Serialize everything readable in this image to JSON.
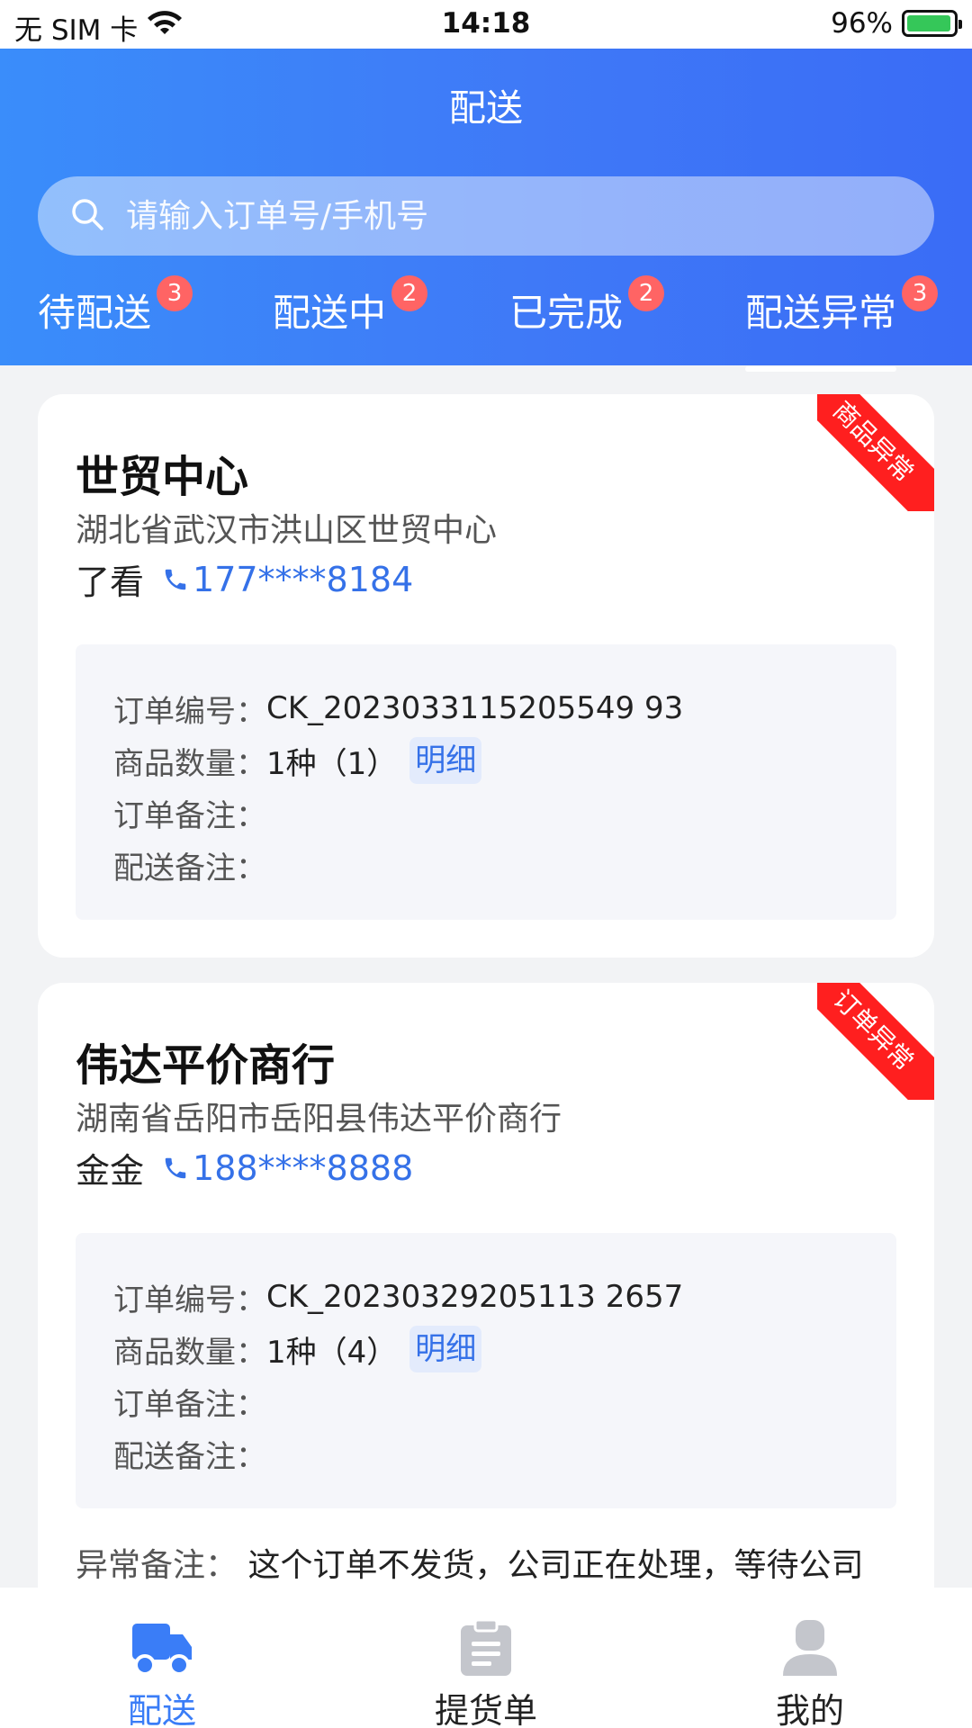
{
  "status_bar": {
    "carrier": "无 SIM 卡",
    "time": "14:18",
    "battery": "96%",
    "battery_level": 0.96
  },
  "header": {
    "title": "配送",
    "search_placeholder": "请输入订单号/手机号"
  },
  "tabs": [
    {
      "label": "待配送",
      "badge": "3"
    },
    {
      "label": "配送中",
      "badge": "2"
    },
    {
      "label": "已完成",
      "badge": "2"
    },
    {
      "label": "配送异常",
      "badge": "3",
      "active": true
    }
  ],
  "orders": [
    {
      "ribbon": "商品异常",
      "shop_name": "世贸中心",
      "address": "湖北省武汉市洪山区世贸中心",
      "contact_name": "了看",
      "phone": "177****8184",
      "order_no_label": "订单编号：",
      "order_no": "CK_2023033115205549 93",
      "qty_label": "商品数量：",
      "qty": "1种（1）",
      "detail_label": "明细",
      "order_remark_label": "订单备注：",
      "delivery_remark_label": "配送备注："
    },
    {
      "ribbon": "订单异常",
      "shop_name": "伟达平价商行",
      "address": "湖南省岳阳市岳阳县伟达平价商行",
      "contact_name": "金金",
      "phone": "188****8888",
      "order_no_label": "订单编号：",
      "order_no": "CK_20230329205113 2657",
      "qty_label": "商品数量：",
      "qty": "1种（4）",
      "detail_label": "明细",
      "order_remark_label": "订单备注：",
      "delivery_remark_label": "配送备注：",
      "exception_label": "异常备注：",
      "exception_text": "这个订单不发货，公司正在处理，等待公司"
    }
  ],
  "bottom_nav": [
    {
      "label": "配送",
      "active": true
    },
    {
      "label": "提货单",
      "active": false
    },
    {
      "label": "我的",
      "active": false
    }
  ],
  "colors": {
    "primary": "#3a7df7",
    "badge": "#ff6464",
    "ribbon": "#ff1f1f",
    "link": "#3571e8",
    "inactive_icon": "#c4c6cc"
  }
}
